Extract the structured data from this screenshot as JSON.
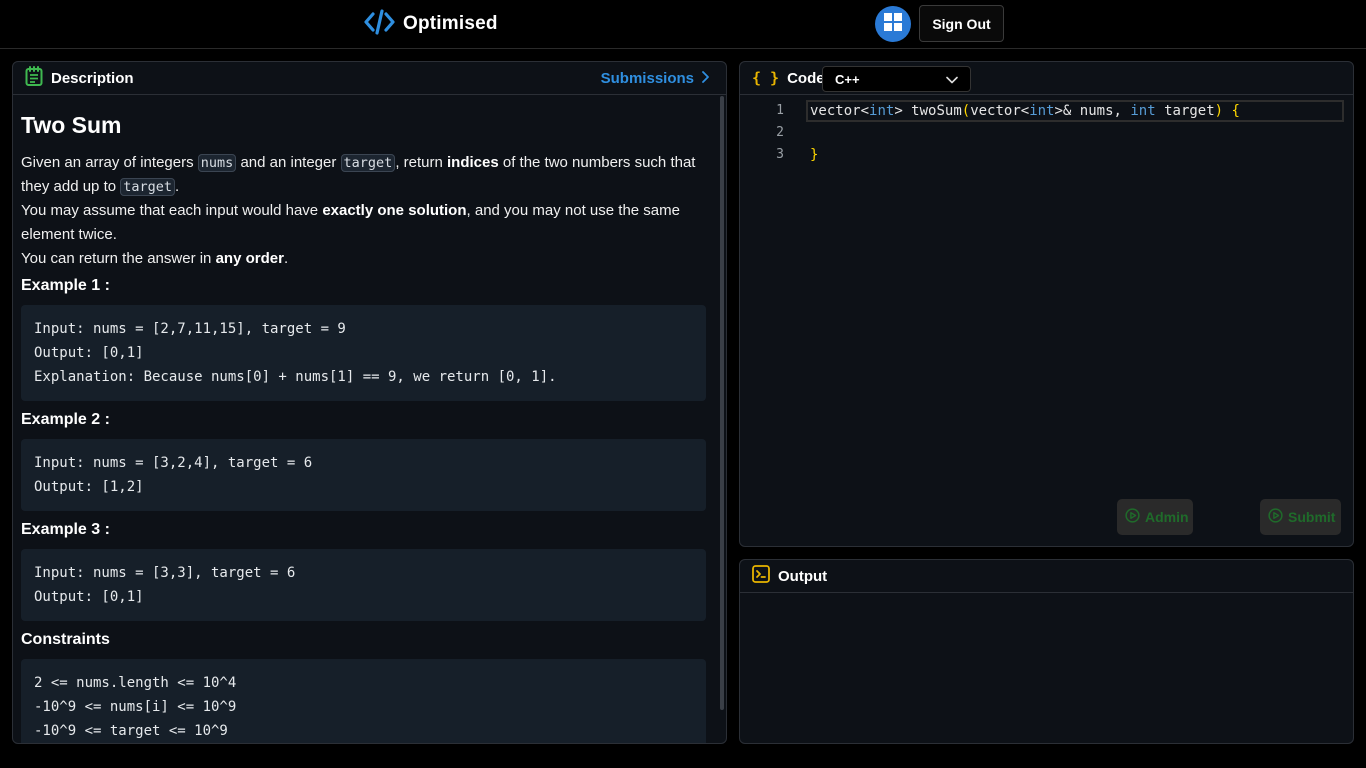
{
  "header": {
    "brand": "Optimised",
    "sign_out": "Sign Out"
  },
  "description": {
    "tab_label": "Description",
    "submissions_label": "Submissions",
    "title": "Two Sum",
    "para1_a": "Given an array of integers ",
    "para1_code1": "nums",
    "para1_b": " and an integer ",
    "para1_code2": "target",
    "para1_c": ", return ",
    "para1_bold": "indices",
    "para1_d": " of the two numbers such that they add up to ",
    "para1_code3": "target",
    "para1_e": ".",
    "para2_a": "You may assume that each input would have ",
    "para2_bold": "exactly one solution",
    "para2_b": ", and you may not use the same element twice.",
    "para3_a": "You can return the answer in ",
    "para3_bold": "any order",
    "para3_b": ".",
    "examples": [
      {
        "title": "Example 1 :",
        "lines": [
          "Input: nums = [2,7,11,15], target = 9",
          "Output: [0,1]",
          "Explanation: Because nums[0] + nums[1] == 9, we return [0, 1]."
        ]
      },
      {
        "title": "Example 2 :",
        "lines": [
          "Input: nums = [3,2,4], target = 6",
          "Output: [1,2]"
        ]
      },
      {
        "title": "Example 3 :",
        "lines": [
          "Input: nums = [3,3], target = 6",
          "Output: [0,1]"
        ]
      }
    ],
    "constraints_title": "Constraints",
    "constraints": [
      "2 <= nums.length <= 10^4",
      "-10^9 <= nums[i] <= 10^9",
      "-10^9 <= target <= 10^9"
    ]
  },
  "code": {
    "tab_label": "Code",
    "braces": "{ }",
    "language": "C++",
    "line_numbers": [
      "1",
      "2",
      "3"
    ],
    "line1_a": "vector<",
    "line1_kw1": "int",
    "line1_b": "> twoSum",
    "line1_paren_open": "(",
    "line1_c": "vector<",
    "line1_kw2": "int",
    "line1_d": ">& nums, ",
    "line1_kw3": "int",
    "line1_e": " target",
    "line1_paren_close": ")",
    "line1_brace": " {",
    "line3_brace": "}",
    "admin_label": "Admin",
    "submit_label": "Submit"
  },
  "output": {
    "tab_label": "Output"
  },
  "colors": {
    "accent_blue": "#2f8fe0",
    "brace_yellow": "#e8b400",
    "keyword_blue": "#569cd6",
    "button_green": "#1f6b2a"
  }
}
